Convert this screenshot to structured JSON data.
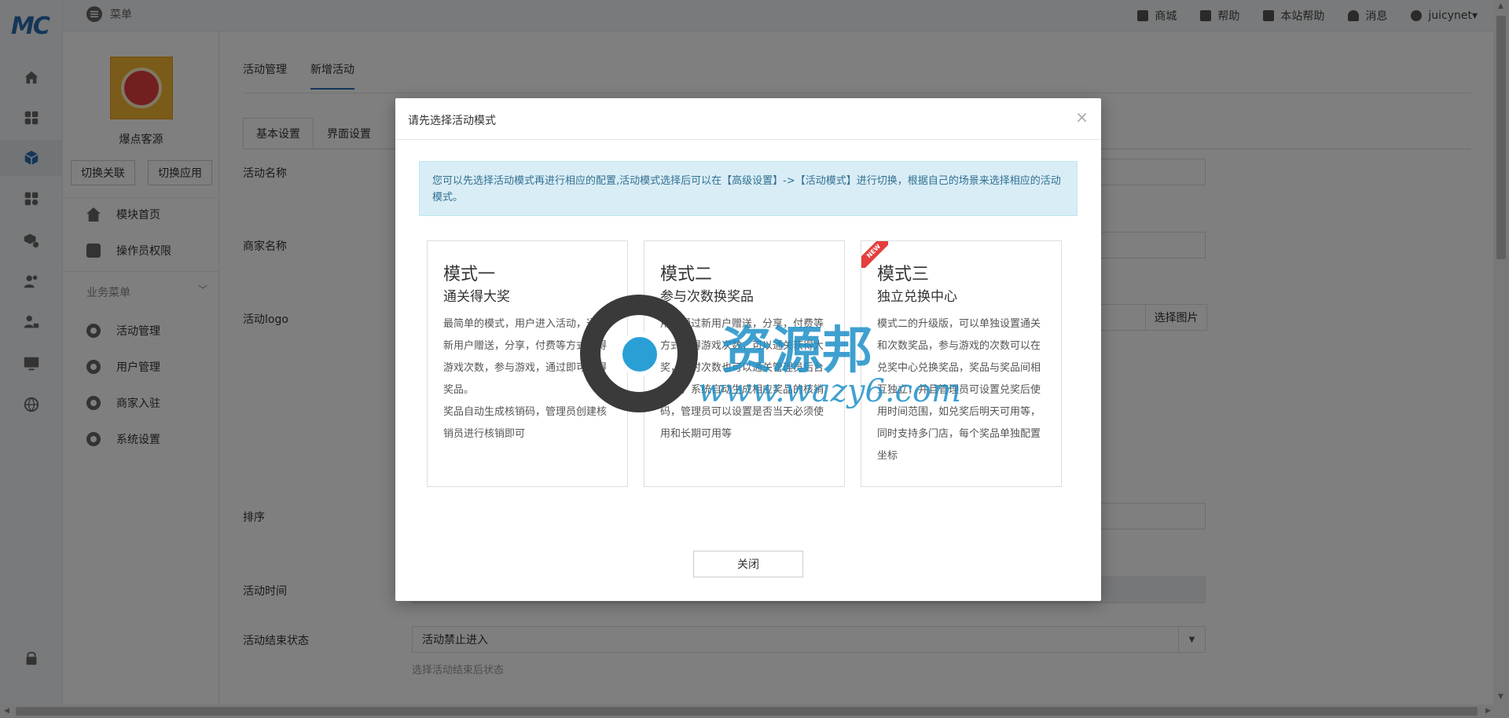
{
  "topbar": {
    "menu_label": "菜单",
    "links": [
      {
        "label": "商城",
        "icon": "store-icon"
      },
      {
        "label": "帮助",
        "icon": "help-icon"
      },
      {
        "label": "本站帮助",
        "icon": "site-help-icon"
      },
      {
        "label": "消息",
        "icon": "bell-icon"
      },
      {
        "label": "juicynet▾",
        "icon": "user-icon"
      }
    ]
  },
  "rail": {
    "logo": "MC",
    "icons": [
      "home-icon",
      "grid-icon",
      "cube-icon",
      "apps-icon",
      "box-gear-icon",
      "users-icon",
      "user-lock-icon",
      "monitor-icon",
      "globe-icon",
      "lock-icon"
    ]
  },
  "sidebar": {
    "shop_name": "爆点客源",
    "btn_switch_link": "切换关联",
    "btn_switch_app": "切换应用",
    "items": [
      {
        "label": "模块首页"
      },
      {
        "label": "操作员权限"
      }
    ],
    "group_title": "业务菜单",
    "group_items": [
      {
        "label": "活动管理"
      },
      {
        "label": "用户管理"
      },
      {
        "label": "商家入驻"
      },
      {
        "label": "系统设置"
      }
    ]
  },
  "main": {
    "tabs": [
      {
        "label": "活动管理"
      },
      {
        "label": "新增活动"
      }
    ],
    "subtabs": [
      {
        "label": "基本设置"
      },
      {
        "label": "界面设置"
      }
    ],
    "fields": {
      "activity_name": "活动名称",
      "merchant_name": "商家名称",
      "activity_logo": "活动logo",
      "pick_image": "选择图片",
      "sort": "排序",
      "activity_time": "活动时间",
      "end_status": "活动结束状态",
      "end_status_value": "活动禁止进入",
      "end_status_hint": "选择活动结束后状态"
    }
  },
  "modal": {
    "title": "请先选择活动模式",
    "close_symbol": "×",
    "notice": "您可以先选择活动模式再进行相应的配置,活动模式选择后可以在【高级设置】->【活动模式】进行切换，根据自己的场景来选择相应的活动模式。",
    "cards": [
      {
        "title": "模式一",
        "subtitle": "通关得大奖",
        "desc1": "最简单的模式，用户进入活动，通过新用户赠送，分享，付费等方式获得游戏次数，参与游戏，通过即可获得奖品。",
        "desc2": "奖品自动生成核销码，管理员创建核销员进行核销即可"
      },
      {
        "title": "模式二",
        "subtitle": "参与次数换奖品",
        "desc1": "用户通过新用户赠送，分享，付费等方式获得游戏次数，可以通关获得大奖，同时次数也可以通关管理员后台设置，系统自动生成相应奖品的核销码，管理员可以设置是否当天必须使用和长期可用等",
        "desc2": ""
      },
      {
        "title": "模式三",
        "subtitle": "独立兑换中心",
        "badge": "NEW",
        "desc1": "模式二的升级版，可以单独设置通关和次数奖品，参与游戏的次数可以在兑奖中心兑换奖品，奖品与奖品间相互独立，并且管理员可设置兑奖后使用时间范围，如兑奖后明天可用等，同时支持多门店，每个奖品单独配置坐标",
        "desc2": ""
      }
    ],
    "close_button": "关闭"
  },
  "watermark": {
    "text": "资源邦",
    "url": "www.wazy6.com"
  }
}
